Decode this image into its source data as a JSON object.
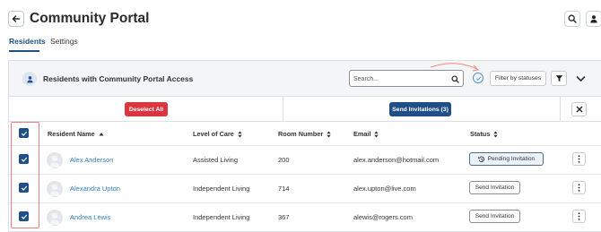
{
  "header": {
    "title": "Community Portal"
  },
  "tabs": [
    {
      "label": "Residents",
      "active": true
    },
    {
      "label": "Settings",
      "active": false
    }
  ],
  "panel": {
    "title": "Residents with Community Portal Access",
    "search_placeholder": "Search...",
    "filter_button": "Filter by statuses",
    "deselect_button": "Deselect All",
    "send_invitations_button": "Send Invitations (3)"
  },
  "table": {
    "columns": [
      "Resident Name",
      "Level of Care",
      "Room Number",
      "Email",
      "Status"
    ],
    "rows": [
      {
        "name": "Alex Anderson",
        "care": "Assisted Living",
        "room": "200",
        "email": "alex.anderson@hotmail.com",
        "status": "Pending Invitation",
        "checked": true
      },
      {
        "name": "Alexandra Upton",
        "care": "Independent Living",
        "room": "714",
        "email": "alex.upton@live.com",
        "status": "Send Invitation",
        "checked": true
      },
      {
        "name": "Andrea Lewis",
        "care": "Independent Living",
        "room": "367",
        "email": "alewis@rogers.com",
        "status": "Send Invitation",
        "checked": true
      }
    ]
  },
  "colors": {
    "brand": "#1f4f86",
    "danger": "#d9363e",
    "link": "#2f7fc1"
  }
}
